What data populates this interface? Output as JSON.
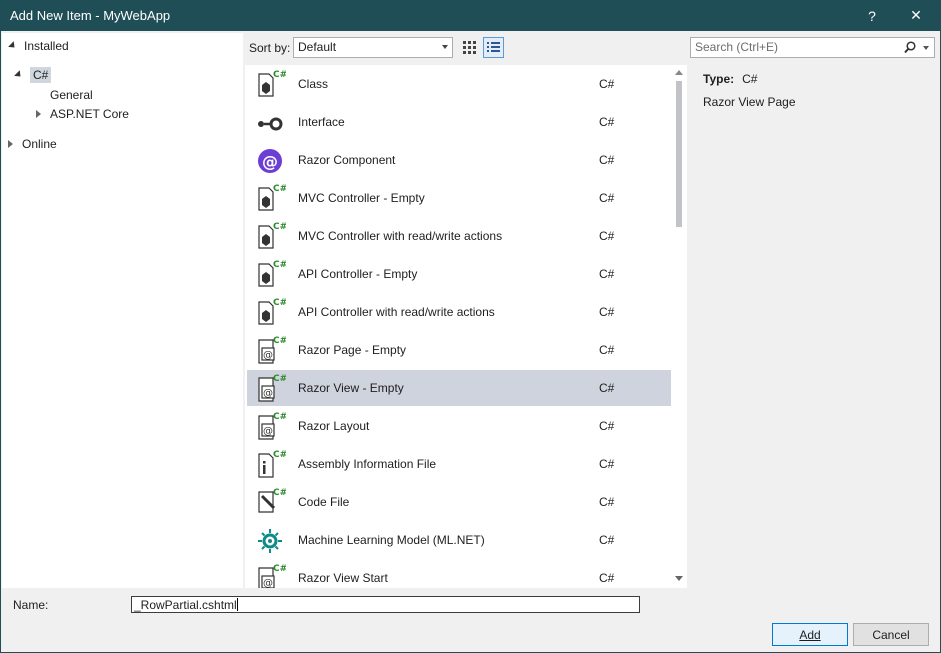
{
  "window": {
    "title": "Add New Item - MyWebApp",
    "help_glyph": "?",
    "close_glyph": "✕"
  },
  "tree": {
    "installed": "Installed",
    "csharp": "C#",
    "general": "General",
    "aspnet": "ASP.NET Core",
    "online": "Online"
  },
  "toolbar": {
    "sort_label": "Sort by:",
    "sort_value": "Default"
  },
  "search": {
    "placeholder": "Search (Ctrl+E)"
  },
  "items": [
    {
      "name": "Class",
      "lang": "C#",
      "icon": "class-template-icon"
    },
    {
      "name": "Interface",
      "lang": "C#",
      "icon": "interface-icon"
    },
    {
      "name": "Razor Component",
      "lang": "C#",
      "icon": "razor-component-icon"
    },
    {
      "name": "MVC Controller - Empty",
      "lang": "C#",
      "icon": "class-template-icon"
    },
    {
      "name": "MVC Controller with read/write actions",
      "lang": "C#",
      "icon": "class-template-icon"
    },
    {
      "name": "API Controller - Empty",
      "lang": "C#",
      "icon": "class-template-icon"
    },
    {
      "name": "API Controller with read/write actions",
      "lang": "C#",
      "icon": "class-template-icon"
    },
    {
      "name": "Razor Page - Empty",
      "lang": "C#",
      "icon": "razor-file-icon"
    },
    {
      "name": "Razor View - Empty",
      "lang": "C#",
      "icon": "razor-file-icon"
    },
    {
      "name": "Razor Layout",
      "lang": "C#",
      "icon": "razor-file-icon"
    },
    {
      "name": "Assembly Information File",
      "lang": "C#",
      "icon": "info-file-icon"
    },
    {
      "name": "Code File",
      "lang": "C#",
      "icon": "code-file-icon"
    },
    {
      "name": "Machine Learning Model (ML.NET)",
      "lang": "C#",
      "icon": "ml-model-icon"
    },
    {
      "name": "Razor View Start",
      "lang": "C#",
      "icon": "razor-file-icon"
    }
  ],
  "selected_index": 8,
  "details": {
    "type_label": "Type:",
    "type_value": "C#",
    "description": "Razor View Page"
  },
  "name_field": {
    "label": "Name:",
    "value": "_RowPartial.cshtml"
  },
  "buttons": {
    "add": "Add",
    "cancel": "Cancel"
  },
  "colors": {
    "titlebar": "#1f4e57",
    "selection": "#cfd3dd",
    "csharp_green": "#2e8b2e",
    "razor_purple": "#6b3fd4",
    "ml_teal": "#0e8a8a"
  }
}
